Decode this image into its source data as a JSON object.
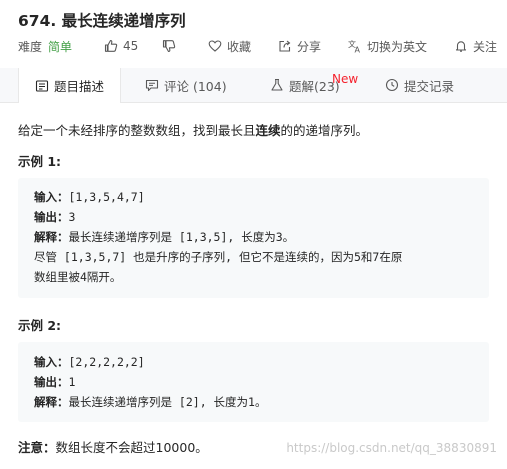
{
  "problem": {
    "title": "674. 最长连续递增序列"
  },
  "meta": {
    "difficulty_label": "难度",
    "difficulty_value": "简单",
    "likes": "45",
    "favorite_label": "收藏",
    "share_label": "分享",
    "translate_label": "切换为英文",
    "follow_label": "关注"
  },
  "tabs": {
    "description": "题目描述",
    "comments": "评论 (104)",
    "solutions": "题解(23)",
    "new_badge": "New",
    "submissions": "提交记录"
  },
  "content": {
    "intro_prefix": "给定一个未经排序的整数数组，找到最长且",
    "intro_bold": "连续",
    "intro_suffix": "的的递增序列。",
    "example1": {
      "heading": "示例 1:",
      "input_key": "输入：",
      "input_val": "[1,3,5,4,7]",
      "output_key": "输出：",
      "output_val": "3",
      "explain_key": "解释：",
      "explain_val": "最长连续递增序列是 [1,3,5], 长度为3。",
      "extra_line1": "尽管 [1,3,5,7] 也是升序的子序列, 但它不是连续的，因为5和7在原",
      "extra_line2": "数组里被4隔开。"
    },
    "example2": {
      "heading": "示例 2:",
      "input_key": "输入：",
      "input_val": "[2,2,2,2,2]",
      "output_key": "输出：",
      "output_val": "1",
      "explain_key": "解释：",
      "explain_val": "最长连续递增序列是 [2], 长度为1。"
    },
    "note_key": "注意：",
    "note_val": "数组长度不会超过10000。"
  },
  "watermark": "https://blog.csdn.net/qq_38830891",
  "colors": {
    "easy_green": "#43a047",
    "new_red": "#f5222d",
    "tab_bg": "#f7f8fa",
    "code_bg": "#f7f9fa"
  }
}
